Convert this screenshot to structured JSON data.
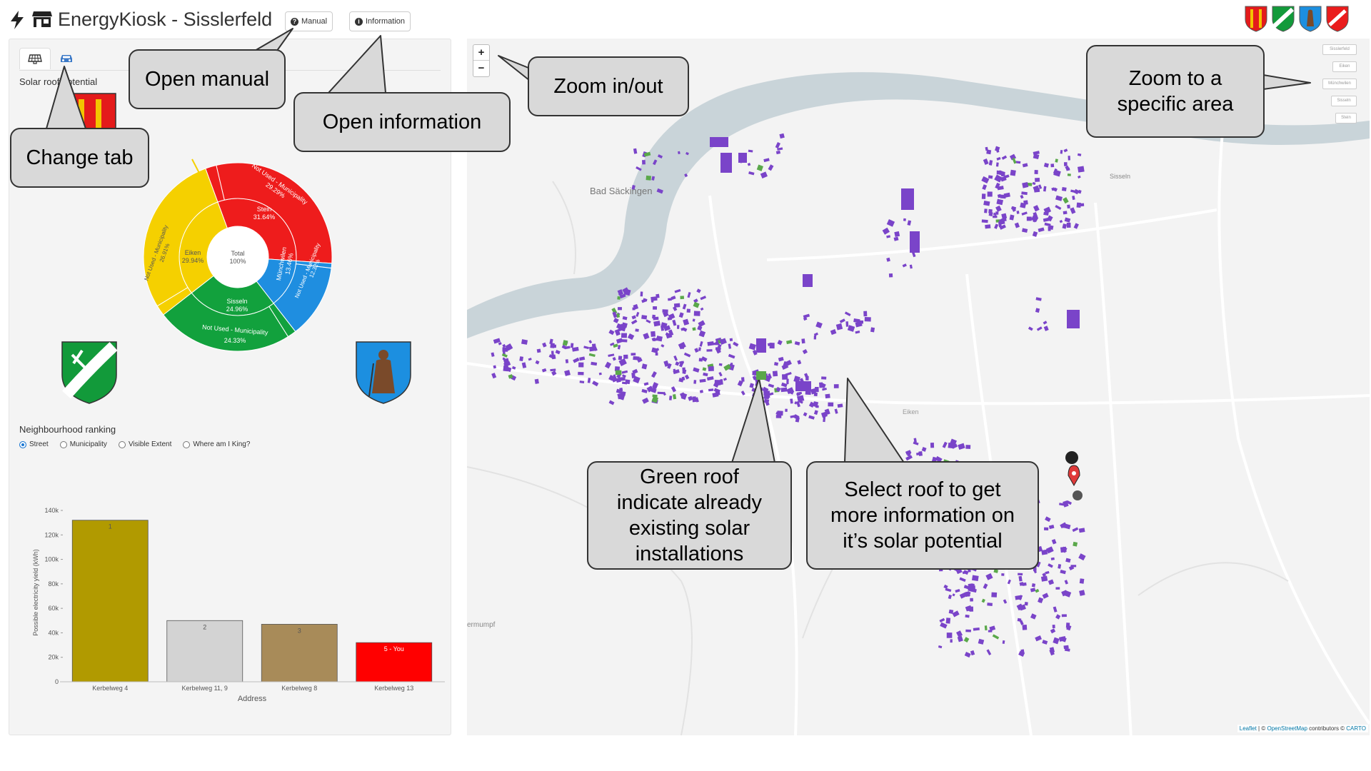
{
  "app": {
    "title": "EnergyKiosk - Sisslеrfeld",
    "manual_label": "Manual",
    "information_label": "Information"
  },
  "sidebar": {
    "section_title": "Solar roof potential",
    "donut": {
      "center_label": "Total",
      "center_value": "100%",
      "inner": [
        {
          "name": "Stein",
          "pct": 31.64,
          "color": "#ee1c1c"
        },
        {
          "name": "Münchwilen",
          "pct": 13.46,
          "color": "#1f8ee0"
        },
        {
          "name": "Sisseln",
          "pct": 24.96,
          "color": "#12a13d"
        },
        {
          "name": "Eiken",
          "pct": 29.94,
          "color": "#f5d000"
        }
      ],
      "labels": {
        "stein_name": "Stein",
        "stein_pct": "31.64%",
        "stein_unused": "Not Used - Municipality",
        "stein_unused_pct": "29.29%",
        "muench_name": "Münchwilen",
        "muench_pct": "13.46%",
        "muench_unused": "Not Used - Municipality",
        "muench_unused_pct": "12.32%",
        "sisseln_name": "Sisseln",
        "sisseln_pct": "24.96%",
        "sisseln_unused": "Not Used - Municipality",
        "sisseln_unused_pct": "24.33%",
        "eiken_name": "Eiken",
        "eiken_pct": "29.94%",
        "eiken_unused": "Not Used - Municipality",
        "eiken_unused_pct": "26.91%"
      }
    },
    "ranking": {
      "title": "Neighbourhood ranking",
      "options": [
        "Street",
        "Municipality",
        "Visible Extent",
        "Where am I King?"
      ],
      "selected": "Street"
    }
  },
  "chart_data": {
    "type": "bar",
    "categories": [
      "Kerbelweg 4",
      "Kerbelweg 11, 9",
      "Kerbelweg 8",
      "Kerbelweg 13"
    ],
    "values": [
      132000,
      50000,
      47000,
      32000
    ],
    "bar_labels": [
      "1",
      "2",
      "3",
      "5 - You"
    ],
    "colors": [
      "#b19a00",
      "#d3d3d3",
      "#a88b59",
      "#ff0000"
    ],
    "ylabel": "Possible electricity yield (kWh)",
    "xlabel": "Address",
    "ylim": [
      0,
      140000
    ],
    "yticks": [
      "0",
      "20k",
      "40k",
      "60k",
      "80k",
      "100k",
      "120k",
      "140k"
    ]
  },
  "map": {
    "zoom_in": "+",
    "zoom_out": "−",
    "place_labels": {
      "bad_saeckingen": "Bad Säckingen",
      "sisseln": "Sisseln",
      "eiken": "Eiken",
      "obermumpf": "ermumpf"
    },
    "area_buttons": [
      "Sisslerfeld",
      "Eiken",
      "Münchwilen",
      "Sisseln",
      "Stein"
    ],
    "attribution": {
      "leaflet": "Leaflet",
      "osm": "OpenStreetMap",
      "contrib": " contributors © ",
      "carto": "CARTO"
    },
    "colors": {
      "roof": "#7a44c9",
      "existing": "#5aa84a",
      "river": "#c9d4d9"
    }
  },
  "callouts": {
    "open_manual": "Open manual",
    "open_information": "Open information",
    "change_tab": "Change tab",
    "zoom_inout": "Zoom in/out",
    "zoom_area": "Zoom to a specific area",
    "green_roof": "Green roof indicate already existing solar installations",
    "select_roof": "Select roof to get more information on it’s solar potential"
  }
}
